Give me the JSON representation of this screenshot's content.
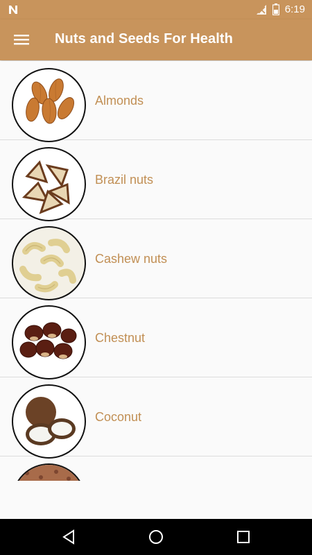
{
  "status_bar": {
    "time": "6:19",
    "icons": [
      "n-logo-icon",
      "signal-off-icon",
      "battery-icon"
    ]
  },
  "app_bar": {
    "title": "Nuts and Seeds For Health",
    "menu_icon": "hamburger-menu-icon"
  },
  "colors": {
    "primary": "#c8945c",
    "item_text": "#c18f54"
  },
  "items": [
    {
      "label": "Almonds",
      "icon": "almonds-image"
    },
    {
      "label": "Brazil nuts",
      "icon": "brazil-nuts-image"
    },
    {
      "label": "Cashew nuts",
      "icon": "cashew-nuts-image"
    },
    {
      "label": "Chestnut",
      "icon": "chestnut-image"
    },
    {
      "label": "Coconut",
      "icon": "coconut-image"
    },
    {
      "label": "",
      "icon": "partially-visible-item-image"
    }
  ],
  "nav_bar": {
    "buttons": [
      "back-icon",
      "home-icon",
      "recents-icon"
    ]
  }
}
